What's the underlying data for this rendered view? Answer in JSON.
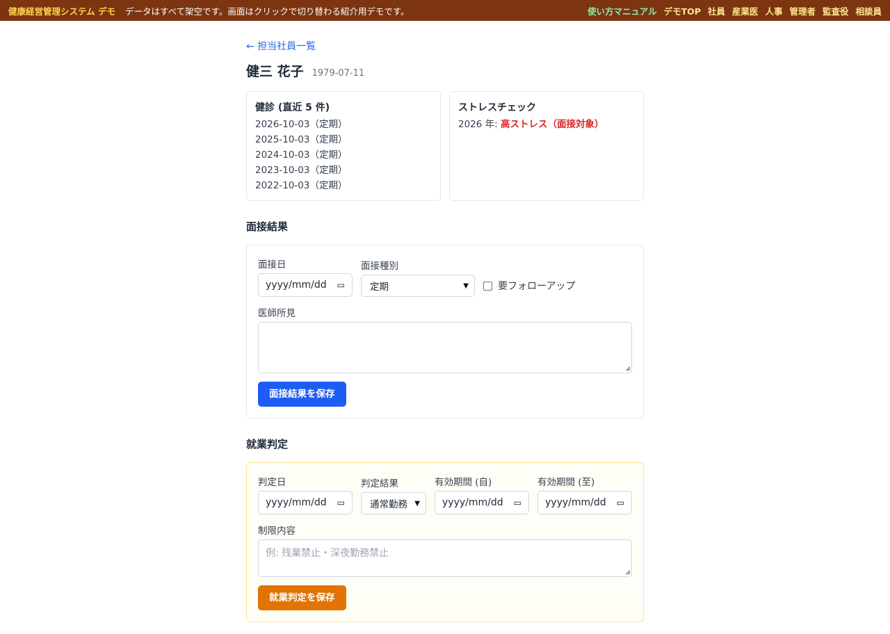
{
  "topbar": {
    "brand": "健康経営管理システム デモ",
    "notice": "データはすべて架空です。画面はクリックで切り替わる紹介用デモです。",
    "nav": [
      "使い方マニュアル",
      "デモTOP",
      "社員",
      "産業医",
      "人事",
      "管理者",
      "監査役",
      "相談員"
    ]
  },
  "back_link": "← 担当社員一覧",
  "employee": {
    "name": "健三 花子",
    "dob": "1979-07-11"
  },
  "health_card": {
    "title": "健診 (直近 5 件)",
    "items": [
      "2026-10-03（定期）",
      "2025-10-03（定期）",
      "2024-10-03（定期）",
      "2023-10-03（定期）",
      "2022-10-03（定期）"
    ]
  },
  "stress_card": {
    "title": "ストレスチェック",
    "year_label": "2026 年:",
    "result": "高ストレス（面接対象）"
  },
  "interview": {
    "section_title": "面接結果",
    "date_label": "面接日",
    "date_placeholder": "yyyy/mm/dd",
    "type_label": "面接種別",
    "type_value": "定期",
    "followup_label": "要フォローアップ",
    "opinion_label": "医師所見",
    "opinion_value": "",
    "save_label": "面接結果を保存"
  },
  "judgment": {
    "section_title": "就業判定",
    "date_label": "判定日",
    "date_placeholder": "yyyy/mm/dd",
    "result_label": "判定結果",
    "result_value": "通常勤務",
    "from_label": "有効期間 (自)",
    "from_placeholder": "yyyy/mm/dd",
    "to_label": "有効期間 (至)",
    "to_placeholder": "yyyy/mm/dd",
    "restriction_label": "制限内容",
    "restriction_placeholder": "例: 残業禁止・深夜勤務禁止",
    "save_label": "就業判定を保存"
  }
}
